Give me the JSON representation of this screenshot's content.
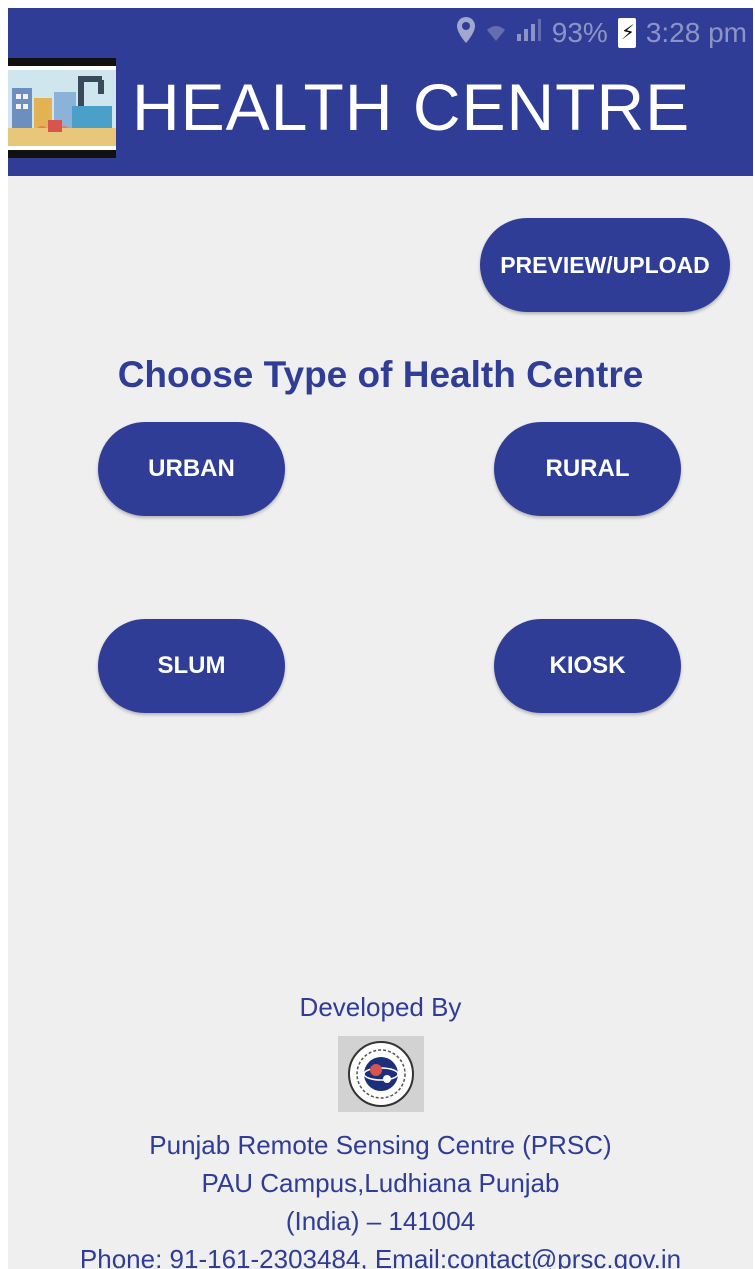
{
  "status_bar": {
    "battery": "93%",
    "time": "3:28 pm",
    "icons": [
      "location-icon",
      "wifi-icon",
      "signal-icon",
      "battery-charging-icon"
    ]
  },
  "header": {
    "title": "HEALTH CENTRE",
    "logo_icon": "health-centre-logo-icon"
  },
  "actions": {
    "preview_upload": "PREVIEW/UPLOAD"
  },
  "choose": {
    "heading": "Choose Type of Health Centre",
    "options": [
      "URBAN",
      "RURAL",
      "SLUM",
      "KIOSK"
    ]
  },
  "footer": {
    "developed_by": "Developed By",
    "org_logo_icon": "prsc-emblem-icon",
    "org_name": "Punjab Remote Sensing Centre (PRSC)",
    "address": "PAU Campus,Ludhiana Punjab",
    "country_pin": "(India) – 141004",
    "contact": "Phone: 91-161-2303484, Email:contact@prsc.gov.in"
  },
  "colors": {
    "primary": "#2f3d96",
    "background": "#efefef",
    "text_on_primary": "#ffffff"
  }
}
